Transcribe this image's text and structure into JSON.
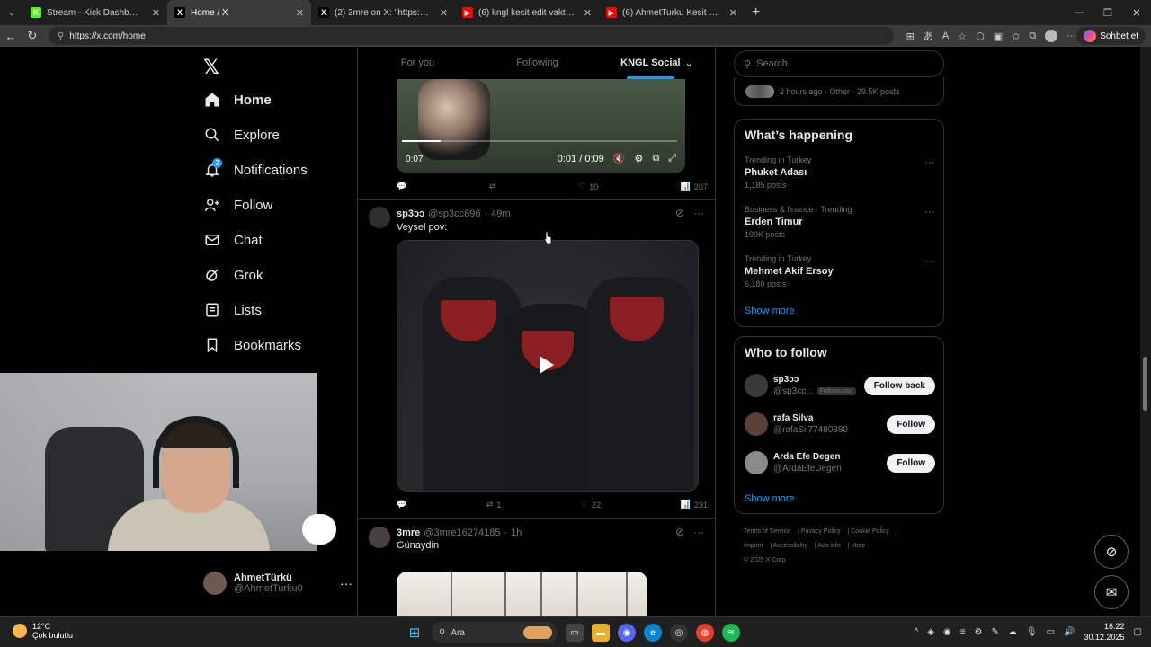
{
  "browser": {
    "tabs": [
      {
        "title": "Stream - Kick Dashboard",
        "favicon": "K",
        "fav_color": "#53fc18",
        "active": false
      },
      {
        "title": "Home / X",
        "favicon": "X",
        "fav_color": "#000000",
        "active": true
      },
      {
        "title": "(2) 3mre on X: \"https://t.co/63FSsl...",
        "favicon": "X",
        "fav_color": "#000000",
        "active": false
      },
      {
        "title": "(6) kngl kesit edit vakti 1 - YouTube",
        "favicon": "▶",
        "fav_color": "#ff0000",
        "active": false
      },
      {
        "title": "(6) AhmetTurku Kesit - YouTube",
        "favicon": "▶",
        "fav_color": "#ff0000",
        "active": false
      }
    ],
    "url": "https://x.com/home",
    "copilot_label": "Sohbet et"
  },
  "nav": {
    "items": [
      {
        "label": "Home",
        "icon": "home-icon"
      },
      {
        "label": "Explore",
        "icon": "search-icon"
      },
      {
        "label": "Notifications",
        "icon": "bell-icon",
        "badge": "2"
      },
      {
        "label": "Follow",
        "icon": "person-add-icon"
      },
      {
        "label": "Chat",
        "icon": "mail-icon"
      },
      {
        "label": "Grok",
        "icon": "grok-icon"
      },
      {
        "label": "Lists",
        "icon": "list-icon"
      },
      {
        "label": "Bookmarks",
        "icon": "bookmark-icon"
      }
    ],
    "account": {
      "name": "AhmetTürkü",
      "handle": "@AhmetTurku0"
    }
  },
  "feed": {
    "tabs": [
      "For you",
      "Following",
      "KNGL Social"
    ],
    "video1": {
      "elapsed": "0:07",
      "time": "0:01 / 0:09",
      "progress": 0.14
    },
    "post1_actions": {
      "replies": "",
      "reposts": "",
      "likes": "10",
      "views": "207"
    },
    "post2": {
      "name": "sp3ɔɔ",
      "handle": "@sp3cc696",
      "time": "49m",
      "text": "Veysel pov:",
      "actions": {
        "replies": "",
        "reposts": "1",
        "likes": "22",
        "views": "231"
      }
    },
    "post3": {
      "name": "3mre",
      "handle": "@3mre16274185",
      "time": "1h",
      "text": "Günaydin"
    }
  },
  "sidebar": {
    "search_placeholder": "Search",
    "prev_meta": "2 hours ago · Other · 29.5K posts",
    "happening_title": "What’s happening",
    "trends": [
      {
        "context": "Trending in Turkey",
        "name": "Phuket Adası",
        "posts": "1,185 posts"
      },
      {
        "context": "Business & finance · Trending",
        "name": "Erden Timur",
        "posts": "190K posts"
      },
      {
        "context": "Trending in Turkey",
        "name": "Mehmet Akif Ersoy",
        "posts": "6,180 posts"
      }
    ],
    "show_more": "Show more",
    "wtf_title": "Who to follow",
    "follows": [
      {
        "name": "sp3ɔɔ",
        "handle": "@sp3cc...",
        "follows_you": "Follows you",
        "button": "Follow back",
        "av_color": "#3a3a3a"
      },
      {
        "name": "rafa Silva",
        "handle": "@rafaSil77480880",
        "follows_you": "",
        "button": "Follow",
        "av_color": "#5b4038"
      },
      {
        "name": "Arda Efe Degen",
        "handle": "@ArdaEfeDegen",
        "follows_you": "",
        "button": "Follow",
        "av_color": "#8a8a8a"
      }
    ],
    "footer": {
      "links": [
        "Terms of Service",
        "Privacy Policy",
        "Cookie Policy",
        "Imprint",
        "Accessibility",
        "Ads info",
        "More ···"
      ],
      "copyright": "© 2025 X Corp."
    }
  },
  "taskbar": {
    "weather_temp": "12°C",
    "weather_desc": "Çok bulutlu",
    "search_label": "Ara",
    "time": "16:22",
    "date": "30.12.2025"
  }
}
